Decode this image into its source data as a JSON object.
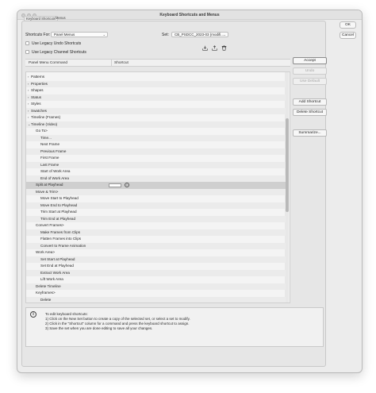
{
  "window": {
    "title": "Keyboard Shortcuts and Menus"
  },
  "tabs": [
    {
      "label": "Keyboard Shortcuts"
    },
    {
      "label": "Menus"
    }
  ],
  "form": {
    "shortcuts_for_label": "Shortcuts For:",
    "shortcuts_for_value": "Panel Menus",
    "set_label": "Set:",
    "set_value": "CB_PSDCC_2023-03 (modifi...",
    "legacy_undo_label": "Use Legacy Undo Shortcuts",
    "legacy_channel_label": "Use Legacy Channel Shortcuts"
  },
  "columns": {
    "command": "Panel Menu Command",
    "shortcut": "Shortcut"
  },
  "rows": [
    {
      "text": "Patterns",
      "indent": 0,
      "caret": true
    },
    {
      "text": "Properties",
      "indent": 0,
      "caret": true
    },
    {
      "text": "Shapes",
      "indent": 0,
      "caret": true
    },
    {
      "text": "Status",
      "indent": 0,
      "caret": true
    },
    {
      "text": "Styles",
      "indent": 0,
      "caret": true
    },
    {
      "text": "Swatches",
      "indent": 0,
      "caret": true
    },
    {
      "text": "Timeline (Frames)",
      "indent": 0,
      "caret": true
    },
    {
      "text": "Timeline (Video)",
      "indent": 0,
      "caret": true,
      "expanded": true
    },
    {
      "text": "Go To>",
      "indent": 1
    },
    {
      "text": "Time...",
      "indent": 2
    },
    {
      "text": "Next Frame",
      "indent": 2
    },
    {
      "text": "Previous Frame",
      "indent": 2
    },
    {
      "text": "First Frame",
      "indent": 2
    },
    {
      "text": "Last Frame",
      "indent": 2
    },
    {
      "text": "Start of Work Area",
      "indent": 2
    },
    {
      "text": "End of Work Area",
      "indent": 2
    },
    {
      "text": "Split at Playhead",
      "indent": 1,
      "selected": true
    },
    {
      "text": "Move & Trim>",
      "indent": 1
    },
    {
      "text": "Move Start to Playhead",
      "indent": 2
    },
    {
      "text": "Move End to Playhead",
      "indent": 2
    },
    {
      "text": "Trim Start at Playhead",
      "indent": 2
    },
    {
      "text": "Trim End at Playhead",
      "indent": 2
    },
    {
      "text": "Convert Frames>",
      "indent": 1
    },
    {
      "text": "Make Frames from Clips",
      "indent": 2
    },
    {
      "text": "Flatten Frames into Clips",
      "indent": 2
    },
    {
      "text": "Convert to Frame Animation",
      "indent": 2
    },
    {
      "text": "Work Area>",
      "indent": 1
    },
    {
      "text": "Set Start at Playhead",
      "indent": 2
    },
    {
      "text": "Set End at Playhead",
      "indent": 2
    },
    {
      "text": "Extract Work Area",
      "indent": 2
    },
    {
      "text": "Lift Work Area",
      "indent": 2
    },
    {
      "text": "Delete Timeline",
      "indent": 1
    },
    {
      "text": "Keyframes>",
      "indent": 1
    },
    {
      "text": "Delete",
      "indent": 2
    }
  ],
  "buttons": {
    "accept": "Accept",
    "undo": "Undo",
    "use_default": "Use Default",
    "add_shortcut": "Add Shortcut",
    "delete_shortcut": "Delete Shortcut",
    "summarize": "Summarize...",
    "ok": "OK",
    "cancel": "Cancel"
  },
  "info": {
    "lines": [
      "To edit keyboard shortcuts:",
      "1) Click on the New Set button to create a copy of the selected set, or select a set to modify.",
      "2) Click in the \"Shortcut\" column for a command and press the keyboard shortcut to assign.",
      "3) Save the set when you are done editing to save all your changes."
    ]
  },
  "icons": {
    "save_set": "save-set-icon",
    "new_set": "new-set-icon",
    "delete_set": "trash-icon",
    "info": "info-icon"
  }
}
